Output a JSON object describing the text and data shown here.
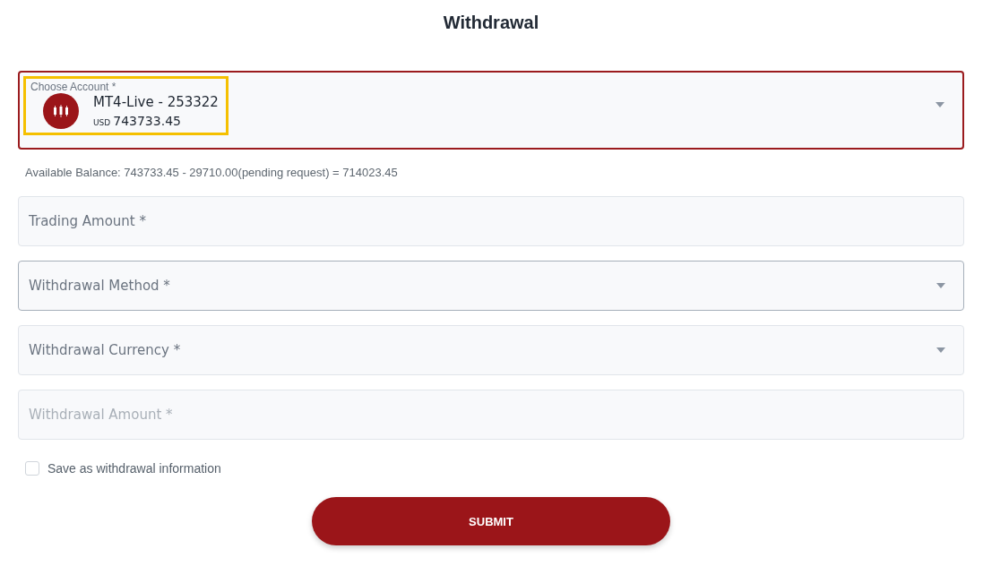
{
  "title": "Withdrawal",
  "account": {
    "label": "Choose Account *",
    "name": "MT4-Live - 253322",
    "currency": "USD",
    "amount": "743733.45",
    "highlighted": true
  },
  "balance_note": "Available Balance: 743733.45 - 29710.00(pending request) = 714023.45",
  "fields": [
    {
      "kind": "text",
      "placeholder": "Trading Amount *",
      "disabled": false,
      "hovered": false
    },
    {
      "kind": "select",
      "placeholder": "Withdrawal Method *",
      "disabled": false,
      "hovered": true
    },
    {
      "kind": "select",
      "placeholder": "Withdrawal Currency *",
      "disabled": false,
      "hovered": false
    },
    {
      "kind": "text",
      "placeholder": "Withdrawal Amount *",
      "disabled": true,
      "hovered": false
    }
  ],
  "save_info": {
    "label": "Save as withdrawal information",
    "checked": false
  },
  "submit": "SUBMIT"
}
